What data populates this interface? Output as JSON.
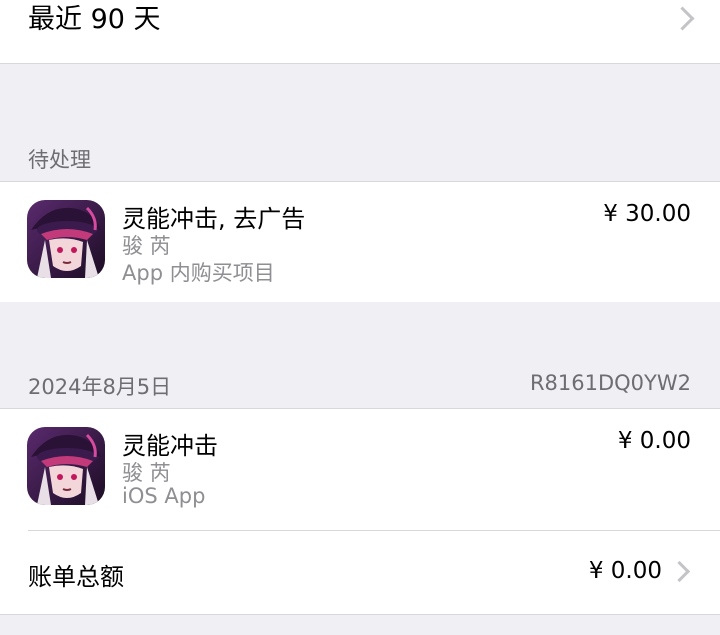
{
  "range": {
    "label": "最近 90 天"
  },
  "pending": {
    "header": "待处理",
    "item": {
      "title": "灵能冲击, 去广告",
      "developer": "骏 芮",
      "type": "App 内购买项目",
      "price": "¥ 30.00"
    }
  },
  "receipt": {
    "date": "2024年8月5日",
    "order_id": "R8161DQ0YW2",
    "item": {
      "title": "灵能冲击",
      "developer": "骏 芮",
      "type": "iOS App",
      "price": "¥ 0.00"
    },
    "total_label": "账单总额",
    "total_value": "¥ 0.00"
  },
  "colors": {
    "background": "#efeff4",
    "card": "#ffffff",
    "secondary_text": "#8e8e93",
    "header_text": "#6d6d72",
    "chevron": "#c4c4c8"
  }
}
